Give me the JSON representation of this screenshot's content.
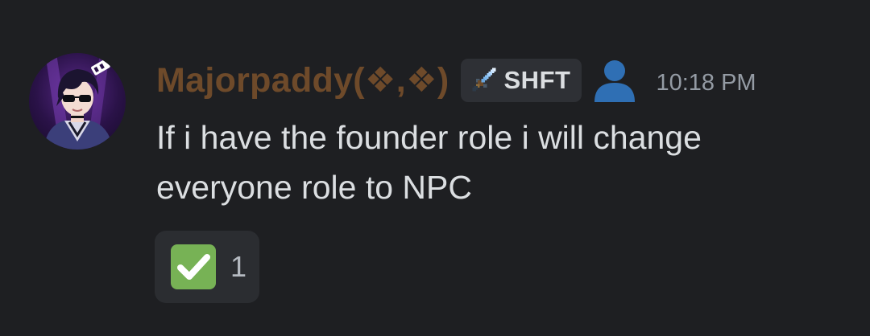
{
  "message": {
    "author": "Majorpaddy(❖,❖)",
    "author_color": "#6e4a2a",
    "guild_tag": {
      "icon": "pixel-sword-icon",
      "label": "SHFT"
    },
    "role_icon": "person-silhouette-icon",
    "timestamp": "10:18 PM",
    "lines": [
      "If i have the founder role i will change",
      "everyone role to NPC"
    ]
  },
  "reactions": [
    {
      "emoji": "white-check-mark-icon",
      "count": "1"
    }
  ]
}
